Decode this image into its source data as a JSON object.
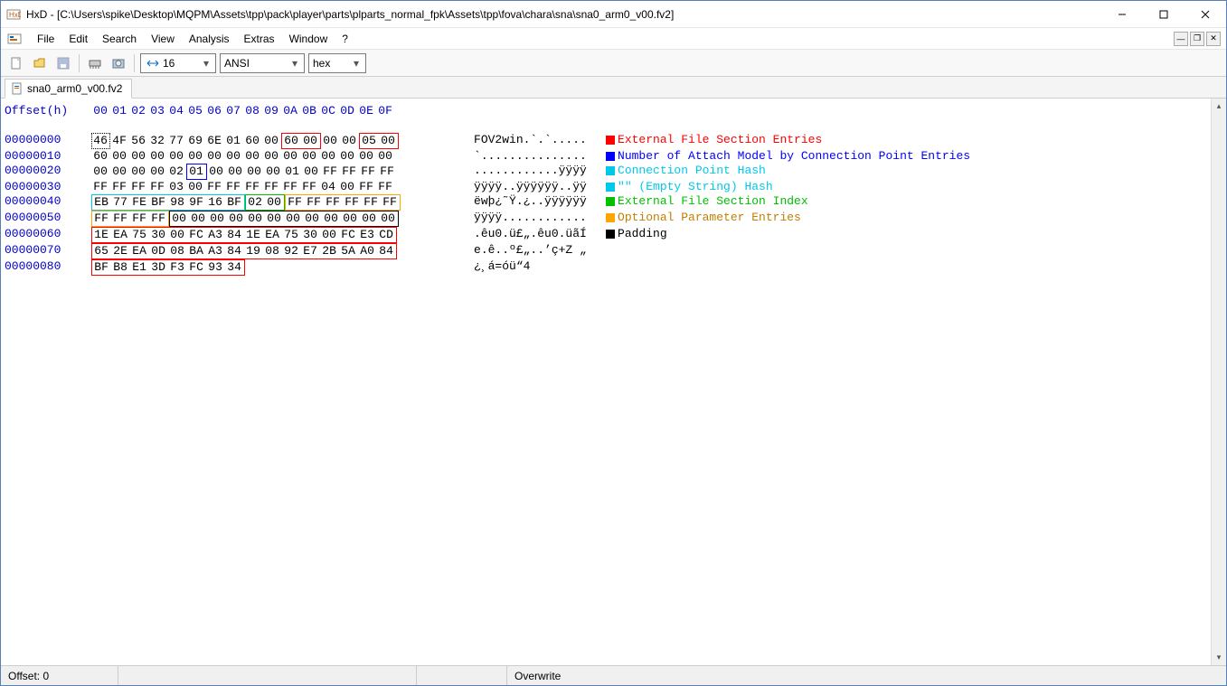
{
  "window": {
    "app_name": "HxD",
    "title": "HxD - [C:\\Users\\spike\\Desktop\\MQPM\\Assets\\tpp\\pack\\player\\parts\\plparts_normal_fpk\\Assets\\tpp\\fova\\chara\\sna\\sna0_arm0_v00.fv2]"
  },
  "menu": {
    "file": "File",
    "edit": "Edit",
    "search": "Search",
    "view": "View",
    "analysis": "Analysis",
    "extras": "Extras",
    "window": "Window",
    "help": "?"
  },
  "toolbar": {
    "bytes_per_row": "16",
    "charset": "ANSI",
    "number_base": "hex"
  },
  "tab": {
    "label": "sna0_arm0_v00.fv2"
  },
  "hex": {
    "header_offset": "Offset(h)",
    "header_cols": [
      "00",
      "01",
      "02",
      "03",
      "04",
      "05",
      "06",
      "07",
      "08",
      "09",
      "0A",
      "0B",
      "0C",
      "0D",
      "0E",
      "0F"
    ],
    "rows": [
      {
        "offset": "00000000",
        "bytes": [
          "46",
          "4F",
          "56",
          "32",
          "77",
          "69",
          "6E",
          "01",
          "60",
          "00",
          "60",
          "00",
          "00",
          "00",
          "05",
          "00"
        ],
        "ascii": "FOV2win.`.`.....",
        "boxes": [
          {
            "start": 10,
            "end": 11,
            "cls": "b-red"
          },
          {
            "start": 14,
            "end": 15,
            "cls": "b-red"
          }
        ]
      },
      {
        "offset": "00000010",
        "bytes": [
          "60",
          "00",
          "00",
          "00",
          "00",
          "00",
          "00",
          "00",
          "00",
          "00",
          "00",
          "00",
          "00",
          "00",
          "00",
          "00"
        ],
        "ascii": "`...............",
        "boxes": []
      },
      {
        "offset": "00000020",
        "bytes": [
          "00",
          "00",
          "00",
          "00",
          "02",
          "01",
          "00",
          "00",
          "00",
          "00",
          "01",
          "00",
          "FF",
          "FF",
          "FF",
          "FF"
        ],
        "ascii": "............ÿÿÿÿ",
        "boxes": [
          {
            "start": 5,
            "end": 5,
            "cls": "b-blue"
          }
        ]
      },
      {
        "offset": "00000030",
        "bytes": [
          "FF",
          "FF",
          "FF",
          "FF",
          "03",
          "00",
          "FF",
          "FF",
          "FF",
          "FF",
          "FF",
          "FF",
          "04",
          "00",
          "FF",
          "FF"
        ],
        "ascii": "ÿÿÿÿ..ÿÿÿÿÿÿ..ÿÿ",
        "boxes": []
      },
      {
        "offset": "00000040",
        "bytes": [
          "EB",
          "77",
          "FE",
          "BF",
          "98",
          "9F",
          "16",
          "BF",
          "02",
          "00",
          "FF",
          "FF",
          "FF",
          "FF",
          "FF",
          "FF"
        ],
        "ascii": "ëwþ¿˜Ÿ.¿..ÿÿÿÿÿÿ",
        "boxes": [
          {
            "start": 0,
            "end": 3,
            "cls": "b-cyan"
          },
          {
            "start": 4,
            "end": 7,
            "cls": "b-cyan"
          },
          {
            "start": 8,
            "end": 9,
            "cls": "b-green"
          },
          {
            "start": 10,
            "end": 11,
            "cls": "b-orange"
          },
          {
            "start": 12,
            "end": 13,
            "cls": "b-orange"
          },
          {
            "start": 14,
            "end": 15,
            "cls": "b-orange"
          }
        ]
      },
      {
        "offset": "00000050",
        "bytes": [
          "FF",
          "FF",
          "FF",
          "FF",
          "00",
          "00",
          "00",
          "00",
          "00",
          "00",
          "00",
          "00",
          "00",
          "00",
          "00",
          "00"
        ],
        "ascii": "ÿÿÿÿ............",
        "boxes": [
          {
            "start": 0,
            "end": 1,
            "cls": "b-orange"
          },
          {
            "start": 2,
            "end": 3,
            "cls": "b-orange"
          },
          {
            "start": 4,
            "end": 15,
            "cls": "b-black"
          }
        ]
      },
      {
        "offset": "00000060",
        "bytes": [
          "1E",
          "EA",
          "75",
          "30",
          "00",
          "FC",
          "A3",
          "84",
          "1E",
          "EA",
          "75",
          "30",
          "00",
          "FC",
          "E3",
          "CD"
        ],
        "ascii": ".êu0.ü£„.êu0.üãÍ",
        "boxes": [
          {
            "start": 0,
            "end": 7,
            "cls": "b-red"
          },
          {
            "start": 8,
            "end": 15,
            "cls": "b-red"
          }
        ]
      },
      {
        "offset": "00000070",
        "bytes": [
          "65",
          "2E",
          "EA",
          "0D",
          "08",
          "BA",
          "A3",
          "84",
          "19",
          "08",
          "92",
          "E7",
          "2B",
          "5A",
          "A0",
          "84"
        ],
        "ascii": "e.ê..º£„..’ç+Z „",
        "boxes": [
          {
            "start": 0,
            "end": 7,
            "cls": "b-red"
          },
          {
            "start": 8,
            "end": 15,
            "cls": "b-red"
          }
        ]
      },
      {
        "offset": "00000080",
        "bytes": [
          "BF",
          "B8",
          "E1",
          "3D",
          "F3",
          "FC",
          "93",
          "34"
        ],
        "ascii": "¿¸á=óü“4",
        "boxes": [
          {
            "start": 0,
            "end": 7,
            "cls": "b-red"
          }
        ]
      }
    ],
    "legend": [
      {
        "row": 0,
        "color": "red",
        "label": "External File Section Entries"
      },
      {
        "row": 1,
        "color": "blue",
        "label": "Number of Attach Model by Connection Point Entries"
      },
      {
        "row": 2,
        "color": "cyan",
        "label": "Connection Point Hash"
      },
      {
        "row": 3,
        "color": "cyan",
        "label": "\"\" (Empty String) Hash"
      },
      {
        "row": 4,
        "color": "green",
        "label": "External File Section Index"
      },
      {
        "row": 5,
        "color": "orange",
        "label": "Optional Parameter Entries"
      },
      {
        "row": 6,
        "color": "black",
        "label": "Padding"
      }
    ]
  },
  "status": {
    "offset_label": "Offset: 0",
    "mode": "Overwrite"
  }
}
